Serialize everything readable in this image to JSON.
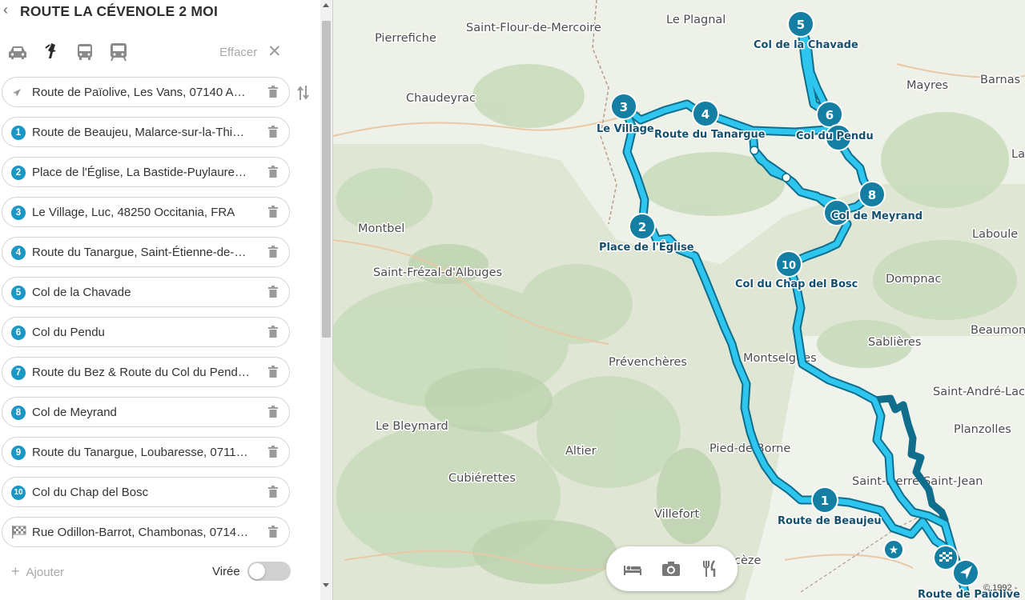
{
  "sidebar": {
    "title": "ROUTE LA CÉVENOLE 2 MOI",
    "clear_label": "Effacer",
    "modes": [
      "car-icon",
      "motorcycle-icon",
      "bus-icon",
      "train-icon"
    ],
    "waypoints": [
      {
        "marker": "start",
        "label": "Route de Païolive, Les Vans, 07140 A…"
      },
      {
        "marker": "1",
        "label": "Route de Beaujeu, Malarce-sur-la-Thi…"
      },
      {
        "marker": "2",
        "label": "Place de l'Église, La Bastide-Puylaure…"
      },
      {
        "marker": "3",
        "label": "Le Village, Luc, 48250 Occitania, FRA"
      },
      {
        "marker": "4",
        "label": "Route du Tanargue, Saint-Étienne-de-…"
      },
      {
        "marker": "5",
        "label": "Col de la Chavade"
      },
      {
        "marker": "6",
        "label": "Col du Pendu"
      },
      {
        "marker": "7",
        "label": "Route du Bez & Route du Col du Pend…"
      },
      {
        "marker": "8",
        "label": "Col de Meyrand"
      },
      {
        "marker": "9",
        "label": "Route du Tanargue, Loubaresse, 0711…"
      },
      {
        "marker": "10",
        "label": "Col du Chap del Bosc"
      },
      {
        "marker": "finish",
        "label": "Rue Odillon-Barrot, Chambonas, 0714…"
      }
    ],
    "add_label": "Ajouter",
    "roundtrip_label": "Virée",
    "roundtrip_on": false
  },
  "map": {
    "places": [
      "Pierrefiche",
      "Saint-Flour-de-Mercoire",
      "Le Plagnal",
      "Mayres",
      "Barnas",
      "Chaudeyrac",
      "Montbel",
      "Laboule",
      "Saint-Frézal-d'Albuges",
      "Dompnac",
      "Beaumon",
      "Sablières",
      "Montselgues",
      "Prévenchères",
      "Saint-André-Lac",
      "Planzolles",
      "Le Bleymard",
      "Altier",
      "Pied-de-Borne",
      "Cubiérettes",
      "Saint-Pierre-Saint-Jean",
      "Villefort",
      "cèze",
      "La"
    ],
    "waypoint_labels": {
      "wp1": "Route de Beaujeu",
      "wp2": "Place de l'Église",
      "wp3": "Le Village",
      "wp4": "Route du Tanargue",
      "wp5": "Col de la Chavade",
      "wp6": "Col du Pendu",
      "wp8": "Col de Meyrand",
      "wp10": "Col du Chap del Bosc",
      "start": "Route de Païolive"
    },
    "route_color": "#29c3ec",
    "route_outline_color": "#0f6e8c",
    "copyright": "© 1992 -"
  },
  "poi_toolbar": [
    "bed-icon",
    "camera-icon",
    "restaurant-icon"
  ]
}
